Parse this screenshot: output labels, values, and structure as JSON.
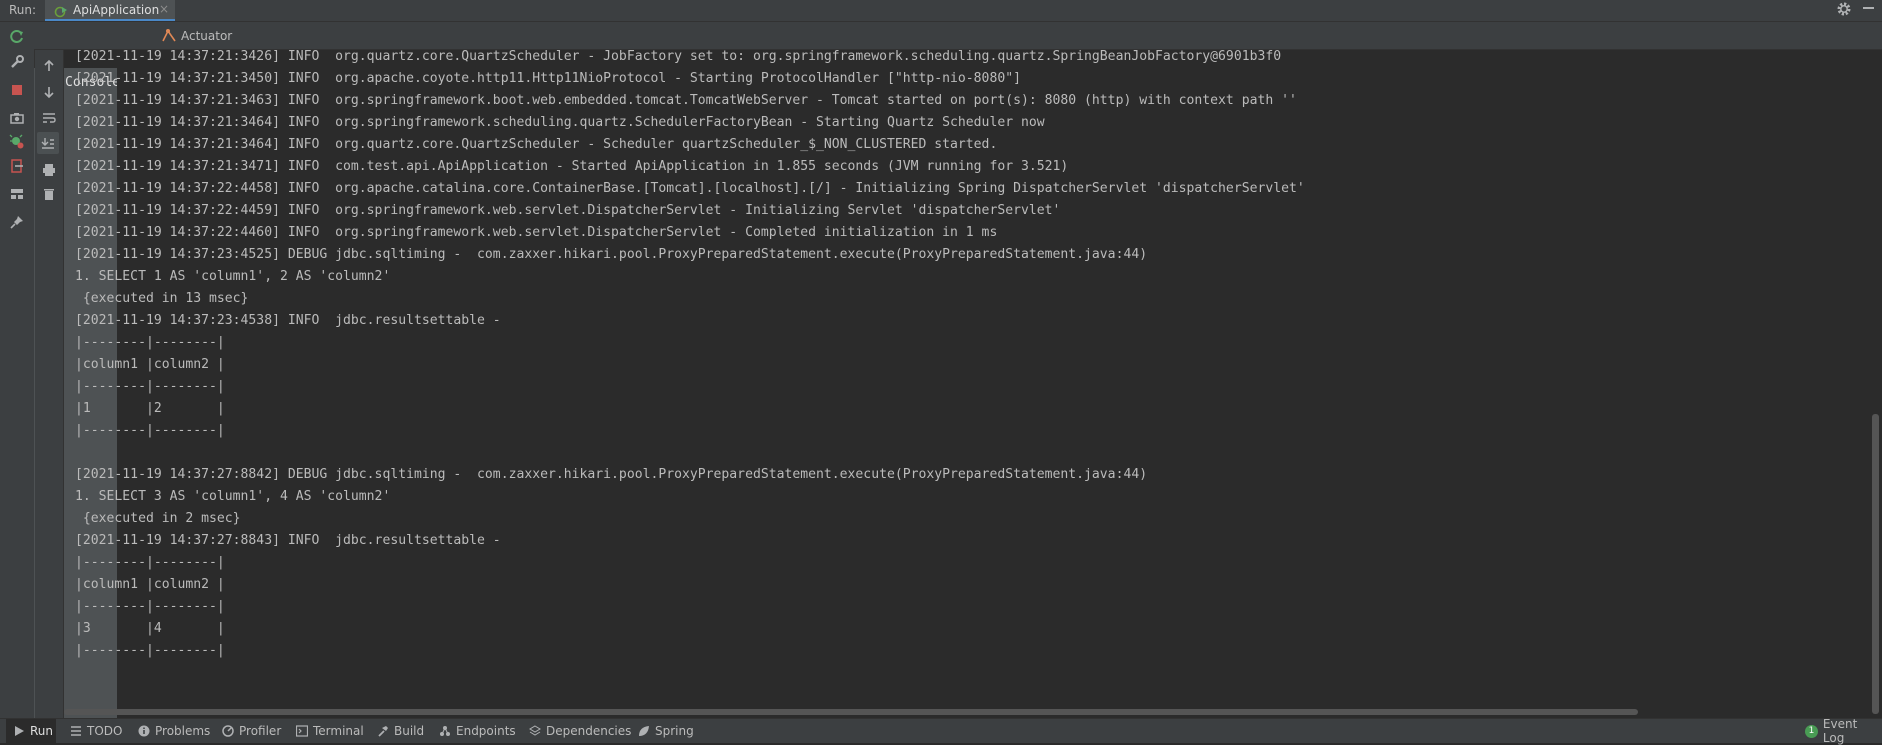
{
  "run_bar": {
    "label": "Run:",
    "tab_label": "ApiApplication",
    "tab_close": "×"
  },
  "sub_tabs": [
    {
      "label": "Console"
    },
    {
      "label": "Actuator"
    }
  ],
  "left_toolbar": {
    "icons": [
      "rerun-icon",
      "wrench-icon",
      "stop-icon",
      "camera-icon",
      "bug-gear-icon",
      "exit-icon",
      "layout-icon",
      "pin-icon"
    ]
  },
  "console_toolbar": {
    "icons": [
      "up-arrow-icon",
      "down-arrow-icon",
      "soft-wrap-icon",
      "scroll-to-end-icon",
      "print-icon",
      "trash-icon"
    ]
  },
  "console": {
    "lines": [
      "[2021-11-19 14:37:21:3426] INFO  org.quartz.core.QuartzScheduler - JobFactory set to: org.springframework.scheduling.quartz.SpringBeanJobFactory@6901b3f0",
      "[2021-11-19 14:37:21:3450] INFO  org.apache.coyote.http11.Http11NioProtocol - Starting ProtocolHandler [\"http-nio-8080\"]",
      "[2021-11-19 14:37:21:3463] INFO  org.springframework.boot.web.embedded.tomcat.TomcatWebServer - Tomcat started on port(s): 8080 (http) with context path ''",
      "[2021-11-19 14:37:21:3464] INFO  org.springframework.scheduling.quartz.SchedulerFactoryBean - Starting Quartz Scheduler now",
      "[2021-11-19 14:37:21:3464] INFO  org.quartz.core.QuartzScheduler - Scheduler quartzScheduler_$_NON_CLUSTERED started.",
      "[2021-11-19 14:37:21:3471] INFO  com.test.api.ApiApplication - Started ApiApplication in 1.855 seconds (JVM running for 3.521)",
      "[2021-11-19 14:37:22:4458] INFO  org.apache.catalina.core.ContainerBase.[Tomcat].[localhost].[/] - Initializing Spring DispatcherServlet 'dispatcherServlet'",
      "[2021-11-19 14:37:22:4459] INFO  org.springframework.web.servlet.DispatcherServlet - Initializing Servlet 'dispatcherServlet'",
      "[2021-11-19 14:37:22:4460] INFO  org.springframework.web.servlet.DispatcherServlet - Completed initialization in 1 ms",
      "[2021-11-19 14:37:23:4525] DEBUG jdbc.sqltiming -  com.zaxxer.hikari.pool.ProxyPreparedStatement.execute(ProxyPreparedStatement.java:44)",
      "1. SELECT 1 AS 'column1', 2 AS 'column2'",
      " {executed in 13 msec}",
      "[2021-11-19 14:37:23:4538] INFO  jdbc.resultsettable -",
      "|--------|--------|",
      "|column1 |column2 |",
      "|--------|--------|",
      "|1       |2       |",
      "|--------|--------|",
      "",
      "[2021-11-19 14:37:27:8842] DEBUG jdbc.sqltiming -  com.zaxxer.hikari.pool.ProxyPreparedStatement.execute(ProxyPreparedStatement.java:44)",
      "1. SELECT 3 AS 'column1', 4 AS 'column2'",
      " {executed in 2 msec}",
      "[2021-11-19 14:37:27:8843] INFO  jdbc.resultsettable -",
      "|--------|--------|",
      "|column1 |column2 |",
      "|--------|--------|",
      "|3       |4       |",
      "|--------|--------|"
    ]
  },
  "bottom_tabs": [
    {
      "label": "Run",
      "icon": "run-icon"
    },
    {
      "label": "TODO",
      "icon": "list-icon"
    },
    {
      "label": "Problems",
      "icon": "info-icon"
    },
    {
      "label": "Profiler",
      "icon": "profiler-icon"
    },
    {
      "label": "Terminal",
      "icon": "terminal-icon"
    },
    {
      "label": "Build",
      "icon": "hammer-icon"
    },
    {
      "label": "Endpoints",
      "icon": "endpoints-icon"
    },
    {
      "label": "Dependencies",
      "icon": "layers-icon"
    },
    {
      "label": "Spring",
      "icon": "spring-leaf-icon"
    }
  ],
  "event_log": {
    "label": "Event Log",
    "count": "1"
  },
  "colors": {
    "background": "#2b2b2b",
    "panel": "#3c3f41",
    "text": "#bbbbbb",
    "accent": "#4a88c7",
    "stop_red": "#c75450",
    "run_green": "#499c54"
  }
}
